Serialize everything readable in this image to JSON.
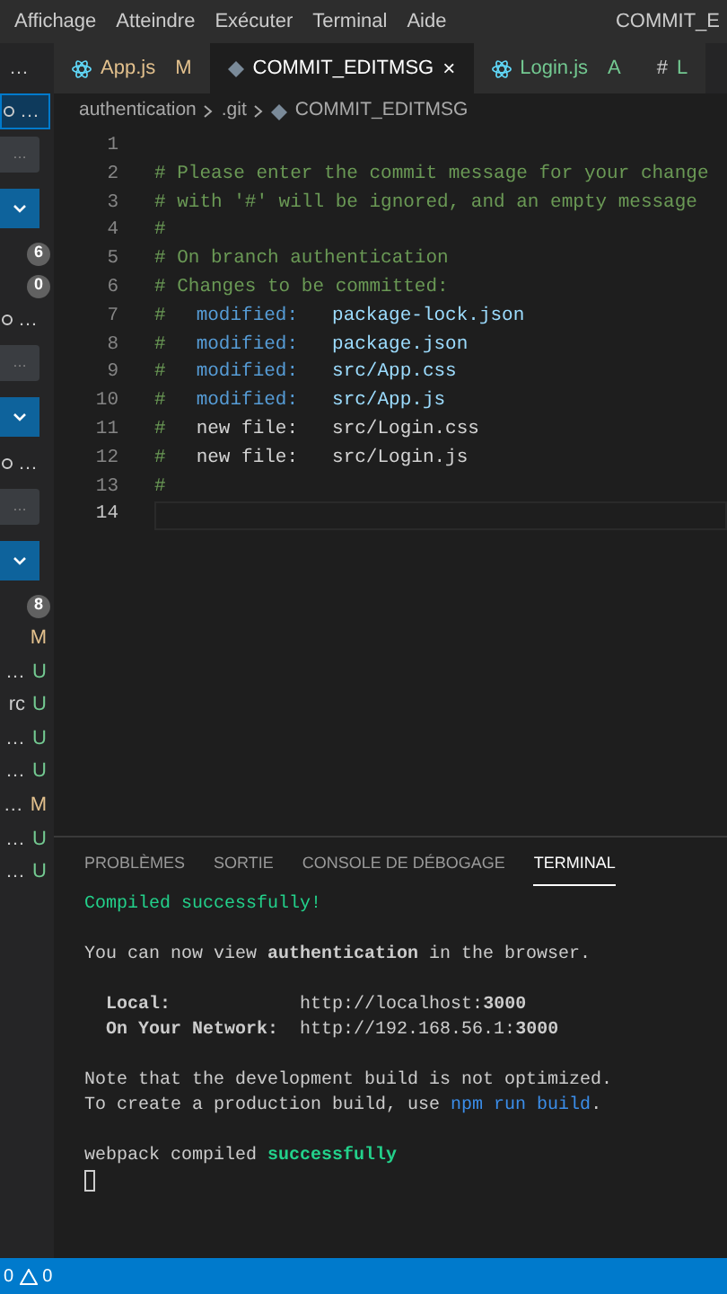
{
  "menu_bar": {
    "items": [
      "Affichage",
      "Atteindre",
      "Exécuter",
      "Terminal",
      "Aide"
    ],
    "title": "COMMIT_E"
  },
  "tabs": {
    "overflow": "…",
    "items": [
      {
        "label": "App.js",
        "status": "M",
        "kind": "script",
        "color": "#e2c08d",
        "selected": false
      },
      {
        "label": "COMMIT_EDITMSG",
        "status": "×",
        "kind": "message",
        "selected": true
      },
      {
        "label": "Login.js",
        "status": "A",
        "kind": "script",
        "color": "#73c991",
        "selected": false
      },
      {
        "label": "L",
        "status": "#",
        "kind": "style",
        "color": "#73c991",
        "selected": false
      }
    ]
  },
  "breadcrumbs": [
    "authentication",
    ".git",
    "COMMIT_EDITMSG"
  ],
  "sidebar": {
    "items": [
      {
        "kind": "more",
        "label": "…",
        "focused": true
      },
      {
        "kind": "button",
        "label": "…"
      },
      {
        "kind": "chevron"
      },
      {
        "kind": "badge",
        "label": "6"
      },
      {
        "kind": "badge",
        "label": "0"
      },
      {
        "kind": "more",
        "label": "…",
        "focused": false
      },
      {
        "kind": "button",
        "label": "…"
      },
      {
        "kind": "chevron"
      },
      {
        "kind": "more",
        "label": "…",
        "focused": false
      },
      {
        "kind": "button",
        "label": "…"
      },
      {
        "kind": "chevron"
      },
      {
        "kind": "badge",
        "label": "8"
      },
      {
        "kind": "file",
        "status": "M",
        "color": "#e2c08d"
      },
      {
        "kind": "file",
        "name": "…",
        "status": "U",
        "color": "#73c991"
      },
      {
        "kind": "file",
        "name": "rc",
        "status": "U",
        "color": "#73c991"
      },
      {
        "kind": "file",
        "name": "…",
        "status": "U",
        "color": "#73c991"
      },
      {
        "kind": "file",
        "name": "…",
        "status": "U",
        "color": "#73c991"
      },
      {
        "kind": "file",
        "name": "…",
        "status": "M",
        "color": "#e2c08d"
      },
      {
        "kind": "file",
        "name": "…",
        "status": "U",
        "color": "#73c991"
      },
      {
        "kind": "file",
        "name": "…",
        "status": "U",
        "color": "#73c991"
      }
    ]
  },
  "editor": {
    "lines": [
      {
        "number": "1",
        "current": false
      },
      {
        "number": "2",
        "current": false,
        "segments": [
          {
            "kind": "comment",
            "text": "# Please enter the commit message for your change"
          }
        ]
      },
      {
        "number": "3",
        "current": false,
        "segments": [
          {
            "kind": "comment",
            "text": "# with '#' will be ignored, and an empty message"
          }
        ]
      },
      {
        "number": "4",
        "current": false,
        "segments": [
          {
            "kind": "comment",
            "text": "#"
          }
        ]
      },
      {
        "number": "5",
        "current": false,
        "segments": [
          {
            "kind": "comment",
            "text": "# On branch authentication"
          }
        ]
      },
      {
        "number": "6",
        "current": false,
        "segments": [
          {
            "kind": "comment",
            "text": "# Changes to be committed:"
          }
        ]
      },
      {
        "number": "7",
        "current": false,
        "segments": [
          {
            "kind": "comment",
            "text": "#"
          },
          {
            "kind": "keyword",
            "text": "modified:"
          },
          {
            "kind": "path",
            "text": "package-lock.json"
          }
        ]
      },
      {
        "number": "8",
        "current": false,
        "segments": [
          {
            "kind": "comment",
            "text": "#"
          },
          {
            "kind": "keyword",
            "text": "modified:"
          },
          {
            "kind": "path",
            "text": "package.json"
          }
        ]
      },
      {
        "number": "9",
        "current": false,
        "segments": [
          {
            "kind": "comment",
            "text": "#"
          },
          {
            "kind": "keyword",
            "text": "modified:"
          },
          {
            "kind": "path",
            "text": "src/App.css"
          }
        ]
      },
      {
        "number": "10",
        "current": false,
        "segments": [
          {
            "kind": "comment",
            "text": "#"
          },
          {
            "kind": "keyword",
            "text": "modified:"
          },
          {
            "kind": "path",
            "text": "src/App.js"
          }
        ]
      },
      {
        "number": "11",
        "current": false,
        "segments": [
          {
            "kind": "comment",
            "text": "#"
          },
          {
            "kind": "plain",
            "text": "new file:"
          },
          {
            "kind": "plain",
            "text": "src/Login.css"
          }
        ]
      },
      {
        "number": "12",
        "current": false,
        "segments": [
          {
            "kind": "comment",
            "text": "#"
          },
          {
            "kind": "plain",
            "text": "new file:"
          },
          {
            "kind": "plain",
            "text": "src/Login.js"
          }
        ]
      },
      {
        "number": "13",
        "current": false,
        "segments": [
          {
            "kind": "comment",
            "text": "#"
          }
        ]
      },
      {
        "number": "14",
        "current": true
      }
    ]
  },
  "panel": {
    "tabs": [
      {
        "label": "PROBLÈMES",
        "selected": false
      },
      {
        "label": "SORTIE",
        "selected": false
      },
      {
        "label": "CONSOLE DE DÉBOGAGE",
        "selected": false
      },
      {
        "label": "TERMINAL",
        "selected": true
      }
    ],
    "terminal": [
      {
        "text": "Compiled successfully!",
        "kind": "success"
      },
      {
        "kind": "blank"
      },
      {
        "text": "You can now view **authentication** in the browser.",
        "kind": "plain"
      },
      {
        "kind": "blank"
      },
      {
        "text": "  **Local:**            http://localhost:**3000**",
        "kind": "plain"
      },
      {
        "text": "  **On Your Network:**  http://192.168.56.1:**3000**",
        "kind": "plain"
      },
      {
        "kind": "blank"
      },
      {
        "text": "Note that the development build is not optimized.",
        "kind": "plain"
      },
      {
        "text": "To create a production build, use ",
        "link": "npm run build",
        "after": ".",
        "kind": "link"
      },
      {
        "kind": "blank"
      },
      {
        "text": "webpack compiled ",
        "bold_success": "successfully",
        "kind": "mixed"
      },
      {
        "kind": "cursor"
      }
    ]
  },
  "status_bar": {
    "errors": "0",
    "warnings": "0"
  }
}
